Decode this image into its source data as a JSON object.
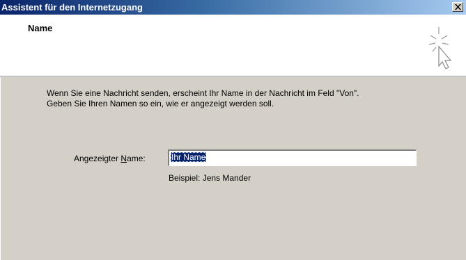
{
  "window": {
    "title": "Assistent für den Internetzugang",
    "close_icon": "close-icon"
  },
  "header": {
    "title": "Name",
    "icon": "wizard-cursor-icon"
  },
  "body": {
    "description_line1": "Wenn Sie eine Nachricht senden, erscheint Ihr Name in der Nachricht im Feld \"Von\".",
    "description_line2": "Geben Sie Ihren Namen so ein, wie er angezeigt werden soll."
  },
  "form": {
    "display_name_label_pre": "Angezeigter ",
    "display_name_label_accel": "N",
    "display_name_label_post": "ame:",
    "display_name_value": "Ihr Name",
    "example": "Beispiel: Jens Mander"
  },
  "colors": {
    "titlebar_start": "#0a246a",
    "titlebar_end": "#a6caf0",
    "dialog_bg": "#d4d0c8",
    "selection": "#0a246a"
  }
}
